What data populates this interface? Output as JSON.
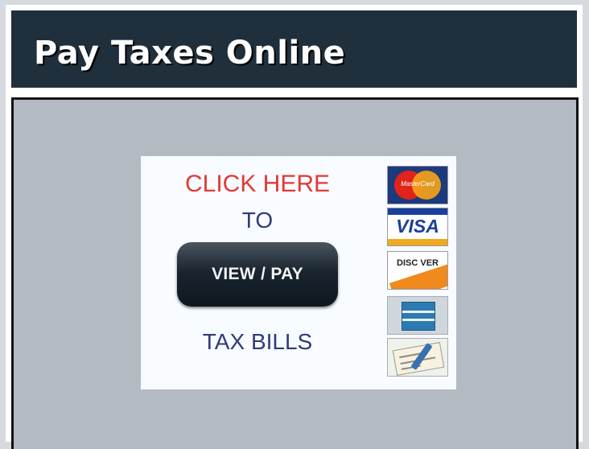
{
  "header": {
    "title": "Pay Taxes Online"
  },
  "banner": {
    "click_here": "CLICK HERE",
    "to": "TO",
    "button_label": "VIEW / PAY",
    "tax_bills": "TAX BILLS"
  },
  "payment_methods": [
    {
      "name": "mastercard-icon",
      "label": "MasterCard"
    },
    {
      "name": "visa-icon",
      "label": "VISA"
    },
    {
      "name": "discover-icon",
      "label": "DISC VER"
    },
    {
      "name": "amex-icon",
      "label": ""
    },
    {
      "name": "echeck-icon",
      "label": ""
    }
  ],
  "colors": {
    "header_bg": "#1f2f3b",
    "content_bg": "#b4bac1",
    "accent_red": "#e03a36",
    "text_navy": "#2f3b78"
  }
}
